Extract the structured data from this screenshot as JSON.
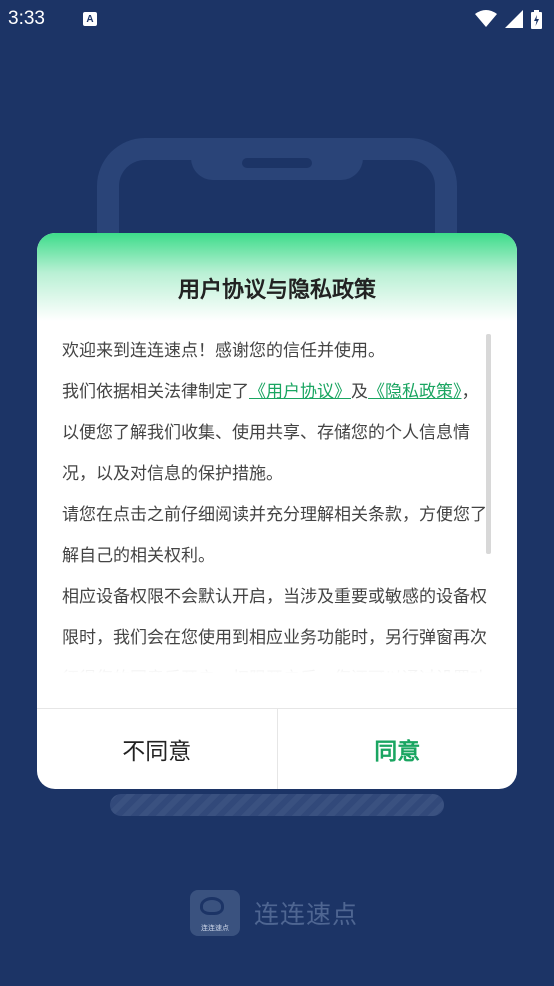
{
  "status_bar": {
    "time": "3:33",
    "notification_icon": "A",
    "icons": [
      "wifi-icon",
      "signal-icon",
      "battery-charging-icon"
    ]
  },
  "brand": {
    "logo_text": "连连速点",
    "name": "连连速点"
  },
  "dialog": {
    "title": "用户协议与隐私政策",
    "para1": "欢迎来到连连速点！感谢您的信任并使用。",
    "para2_prefix": "我们依据相关法律制定了",
    "link_user_agreement": "《用户协议》",
    "para2_mid": "及",
    "link_privacy_policy": "《隐私政策》",
    "para2_suffix": "，以便您了解我们收集、使用共享、存储您的个人信息情况，以及对信息的保护措施。",
    "para3": "请您在点击之前仔细阅读并充分理解相关条款，方便您了解自己的相关权利。",
    "para4": "相应设备权限不会默认开启，当涉及重要或敏感的设备权限时，我们会在您使用到相应业务功能时，另行弹窗再次征得您的同意后开启；权限开启后，您还可以通过设置功能随时关闭。",
    "disagree_label": "不同意",
    "agree_label": "同意"
  },
  "colors": {
    "background": "#1c3466",
    "accent_green": "#1aa561",
    "header_gradient_top": "#3ddc8a"
  }
}
